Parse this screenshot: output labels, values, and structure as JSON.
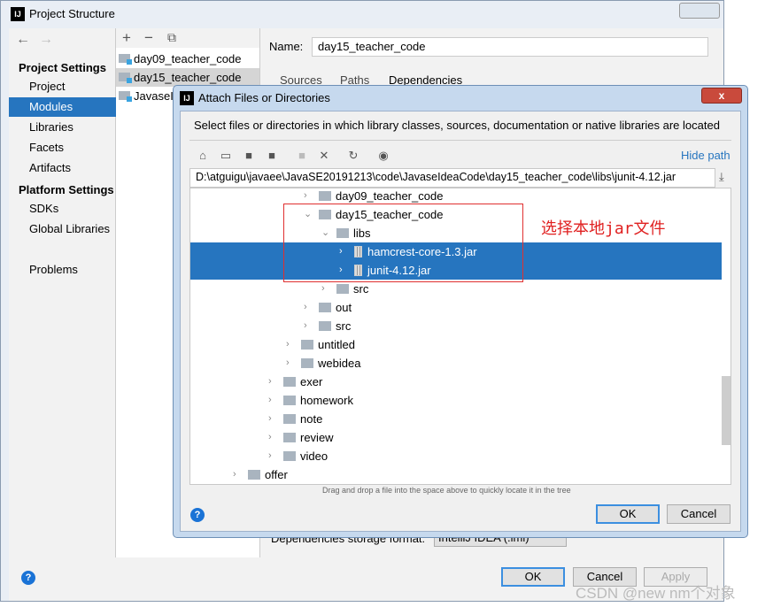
{
  "window": {
    "title": "Project Structure",
    "logo": "IJ"
  },
  "nav": {
    "back_icon": "arrow-left-icon",
    "forward_icon": "arrow-right-icon",
    "project_settings": "Project Settings",
    "items_ps": [
      "Project",
      "Modules",
      "Libraries",
      "Facets",
      "Artifacts"
    ],
    "platform_settings": "Platform Settings",
    "items_pl": [
      "SDKs",
      "Global Libraries"
    ],
    "problems": "Problems",
    "selected": "Modules"
  },
  "modules": {
    "toolbar": [
      "plus-icon",
      "minus-icon",
      "copy-icon"
    ],
    "add": "+",
    "remove": "−",
    "copy": "⧉",
    "items": [
      "day09_teacher_code",
      "day15_teacher_code",
      "JavaseI"
    ]
  },
  "right": {
    "name_label": "Name:",
    "name_value": "day15_teacher_code",
    "tabs": [
      "Sources",
      "Paths",
      "Dependencies"
    ],
    "storage_label": "Dependencies storage format:",
    "storage_value": "IntelliJ IDEA (.iml)"
  },
  "footer": {
    "ok": "OK",
    "cancel": "Cancel",
    "apply": "Apply",
    "help": "?"
  },
  "dialog": {
    "title": "Attach Files or Directories",
    "close": "x",
    "description": "Select files or directories in which library classes, sources, documentation or native libraries are located",
    "hide_path": "Hide path",
    "path": "D:\\atguigu\\javaee\\JavaSE20191213\\code\\JavaseIdeaCode\\day15_teacher_code\\libs\\junit-4.12.jar",
    "drag_hint": "Drag and drop a file into the space above to quickly locate it in the tree",
    "ok": "OK",
    "cancel": "Cancel",
    "help": "?",
    "toolbar": [
      "home-icon",
      "desktop-icon",
      "project-folder-icon",
      "module-folder-icon",
      "new-folder-icon",
      "delete-icon",
      "refresh-icon",
      "show-hidden-icon"
    ],
    "tree": [
      {
        "label": "day09_teacher_code",
        "depth": 4,
        "type": "folder",
        "expanded": false,
        "selected": false
      },
      {
        "label": "day15_teacher_code",
        "depth": 4,
        "type": "folder",
        "expanded": true,
        "selected": false
      },
      {
        "label": "libs",
        "depth": 5,
        "type": "folder",
        "expanded": true,
        "selected": false
      },
      {
        "label": "hamcrest-core-1.3.jar",
        "depth": 6,
        "type": "jar",
        "expanded": false,
        "selected": true
      },
      {
        "label": "junit-4.12.jar",
        "depth": 6,
        "type": "jar",
        "expanded": false,
        "selected": true
      },
      {
        "label": "src",
        "depth": 5,
        "type": "folder",
        "expanded": false,
        "selected": false
      },
      {
        "label": "out",
        "depth": 4,
        "type": "folder",
        "expanded": false,
        "selected": false
      },
      {
        "label": "src",
        "depth": 4,
        "type": "folder",
        "expanded": false,
        "selected": false
      },
      {
        "label": "untitled",
        "depth": 3,
        "type": "folder",
        "expanded": false,
        "selected": false
      },
      {
        "label": "webidea",
        "depth": 3,
        "type": "folder",
        "expanded": false,
        "selected": false
      },
      {
        "label": "exer",
        "depth": 2,
        "type": "folder",
        "expanded": false,
        "selected": false
      },
      {
        "label": "homework",
        "depth": 2,
        "type": "folder",
        "expanded": false,
        "selected": false
      },
      {
        "label": "note",
        "depth": 2,
        "type": "folder",
        "expanded": false,
        "selected": false
      },
      {
        "label": "review",
        "depth": 2,
        "type": "folder",
        "expanded": false,
        "selected": false
      },
      {
        "label": "video",
        "depth": 2,
        "type": "folder",
        "expanded": false,
        "selected": false
      },
      {
        "label": "offer",
        "depth": 0,
        "type": "folder",
        "expanded": false,
        "selected": false
      }
    ]
  },
  "annotation": "选择本地jar文件",
  "watermark": "CSDN @new nm个对象",
  "colors": {
    "selection": "#2675bf",
    "accent_link": "#2675bf",
    "annotation": "#e02020"
  }
}
